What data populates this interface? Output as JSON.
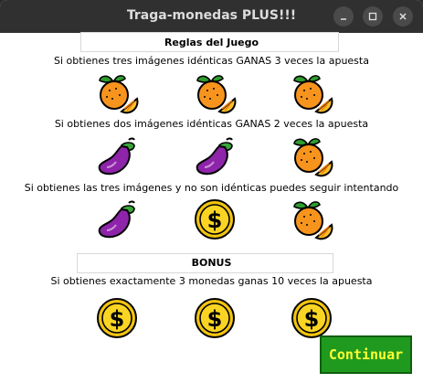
{
  "window": {
    "title": "Traga-monedas PLUS!!!",
    "controls": [
      "minimize",
      "maximize",
      "close"
    ]
  },
  "rules": {
    "heading": "Reglas del Juego",
    "rows": [
      {
        "text": "Si obtienes tres imágenes idénticas GANAS 3 veces la apuesta",
        "icons": [
          "orange-icon",
          "orange-icon",
          "orange-icon"
        ]
      },
      {
        "text": "Si obtienes dos imágenes idénticas GANAS 2 veces la apuesta",
        "icons": [
          "eggplant-icon",
          "eggplant-icon",
          "orange-icon"
        ]
      },
      {
        "text": "Si obtienes las tres imágenes y no son idénticas puedes seguir intentando",
        "icons": [
          "eggplant-icon",
          "coin-icon",
          "orange-icon"
        ]
      }
    ]
  },
  "bonus": {
    "heading": "BONUS",
    "text": "Si obtienes exactamente 3 monedas ganas 10 veces la apuesta",
    "icons": [
      "coin-icon",
      "coin-icon",
      "coin-icon"
    ]
  },
  "continue_button": {
    "label": "Continuar"
  },
  "colors": {
    "titlebar": "#303030",
    "button_bg": "#1f9a1f",
    "button_text": "#ffff33",
    "orange": "#f7941d",
    "eggplant": "#8e24aa",
    "coin": "#f2c40f"
  }
}
